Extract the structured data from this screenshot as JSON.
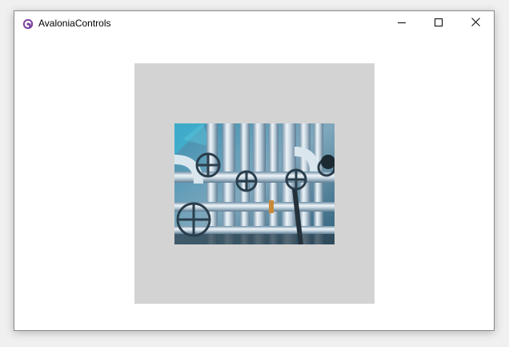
{
  "window": {
    "title": "AvaloniaControls",
    "icon": "avalonia-logo-icon",
    "controls": [
      "minimize-icon",
      "maximize-icon",
      "close-icon"
    ],
    "accent_color": "#7b3fa0"
  },
  "content": {
    "panel_color": "#d3d3d3",
    "image": "industrial-pipes-valves-photo"
  }
}
